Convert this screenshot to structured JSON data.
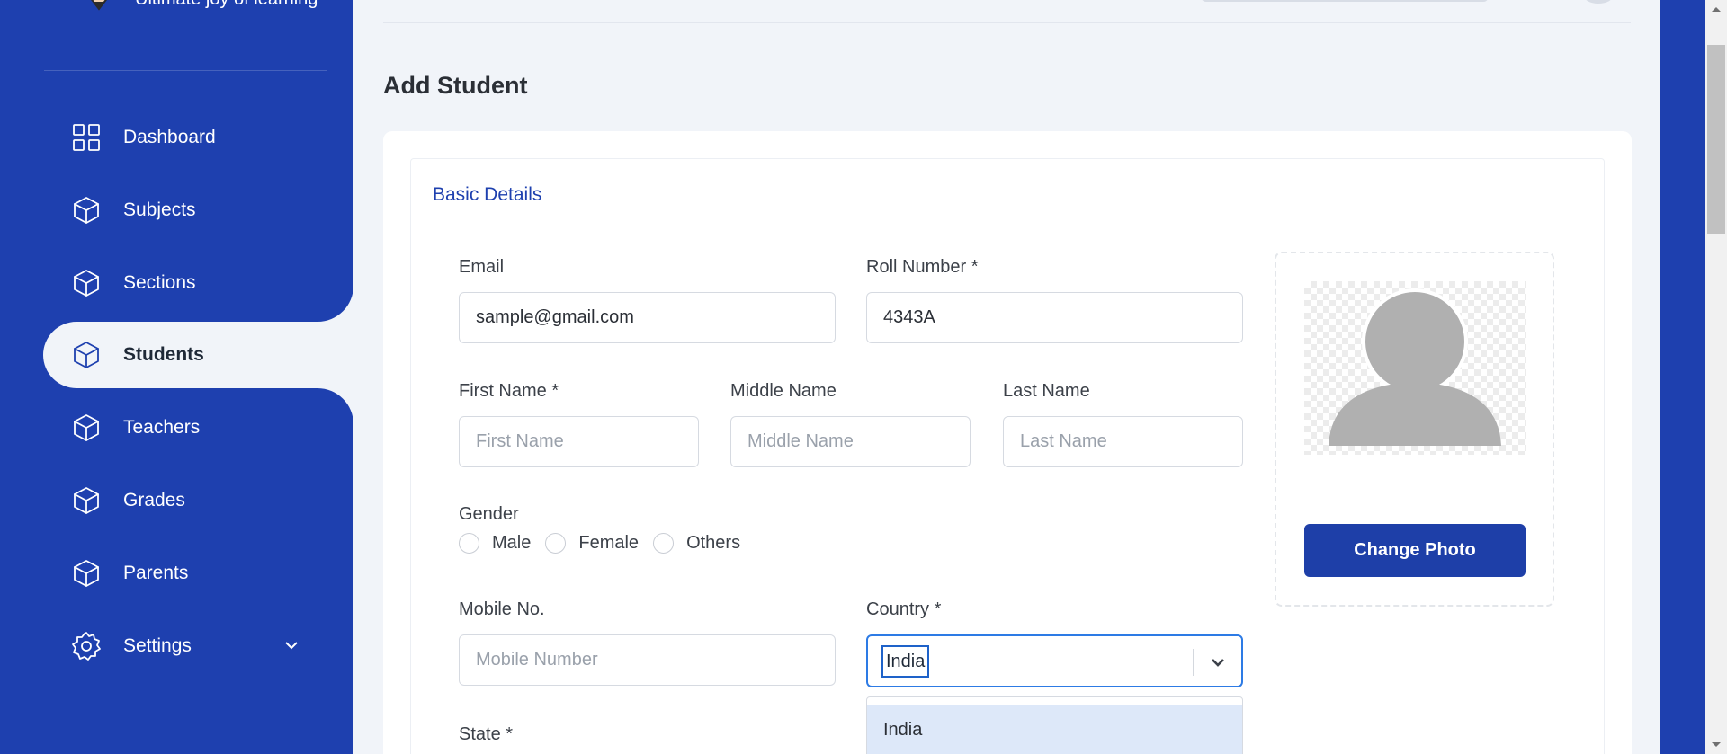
{
  "brand": {
    "tagline": "Ultimate joy of learning",
    "logo_icon": "pencil-logo-icon"
  },
  "sidebar": {
    "items": [
      {
        "label": "Dashboard",
        "icon": "grid-icon"
      },
      {
        "label": "Subjects",
        "icon": "cube-icon"
      },
      {
        "label": "Sections",
        "icon": "cube-icon"
      },
      {
        "label": "Students",
        "icon": "cube-icon",
        "active": true
      },
      {
        "label": "Teachers",
        "icon": "cube-icon"
      },
      {
        "label": "Grades",
        "icon": "cube-icon"
      },
      {
        "label": "Parents",
        "icon": "cube-icon"
      },
      {
        "label": "Settings",
        "icon": "gear-icon",
        "has_chevron": true
      }
    ]
  },
  "page": {
    "title": "Add Student",
    "section_title": "Basic Details"
  },
  "form": {
    "email": {
      "label": "Email",
      "value": "sample@gmail.com"
    },
    "roll_number": {
      "label": "Roll Number *",
      "value": "4343A"
    },
    "first_name": {
      "label": "First Name *",
      "placeholder": "First Name"
    },
    "middle_name": {
      "label": "Middle Name",
      "placeholder": "Middle Name"
    },
    "last_name": {
      "label": "Last Name",
      "placeholder": "Last Name"
    },
    "gender": {
      "label": "Gender",
      "options": [
        "Male",
        "Female",
        "Others"
      ]
    },
    "mobile": {
      "label": "Mobile No.",
      "placeholder": "Mobile Number"
    },
    "country": {
      "label": "Country *",
      "value": "India",
      "dropdown_options": [
        "India"
      ]
    },
    "state": {
      "label": "State *"
    }
  },
  "photo": {
    "button_label": "Change Photo"
  },
  "colors": {
    "sidebar": "#1e40af",
    "accent": "#1e40af",
    "focus": "#2d7be5",
    "option_highlight": "#dde8f9"
  }
}
